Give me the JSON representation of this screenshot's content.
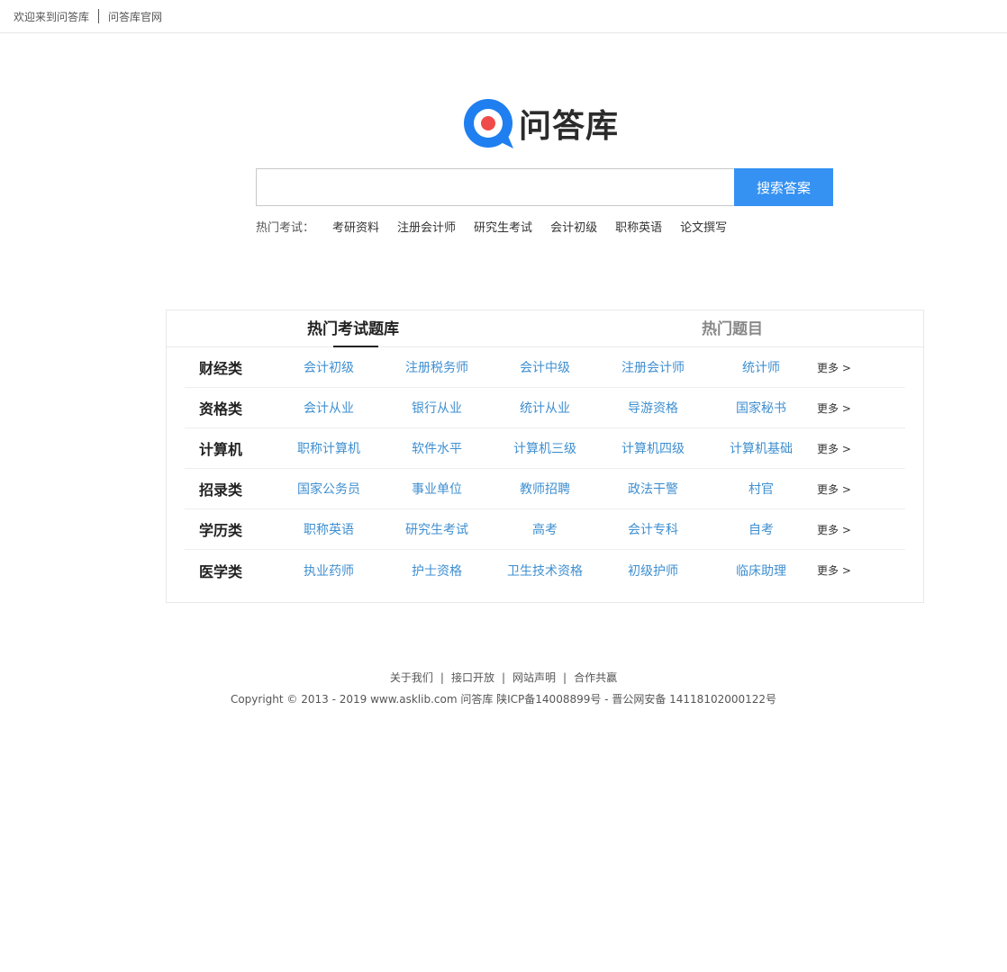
{
  "topbar": {
    "welcome": "欢迎来到问答库",
    "official_site": "问答库官网"
  },
  "logo": {
    "text": "问答库",
    "colors": {
      "ring": "#1f7ff0",
      "dot": "#ef4b4b"
    }
  },
  "search": {
    "placeholder": "",
    "button_label": "搜索答案",
    "button_color": "#3591f2"
  },
  "hot": {
    "label": "热门考试：",
    "items": [
      "考研资料",
      "注册会计师",
      "研究生考试",
      "会计初级",
      "职称英语",
      "论文撰写"
    ]
  },
  "panel": {
    "tabs": [
      "热门考试题库",
      "热门题目"
    ],
    "more_label": "更多 >",
    "rows": [
      {
        "category": "财经类",
        "links": [
          "会计初级",
          "注册税务师",
          "会计中级",
          "注册会计师",
          "统计师"
        ]
      },
      {
        "category": "资格类",
        "links": [
          "会计从业",
          "银行从业",
          "统计从业",
          "导游资格",
          "国家秘书"
        ]
      },
      {
        "category": "计算机",
        "links": [
          "职称计算机",
          "软件水平",
          "计算机三级",
          "计算机四级",
          "计算机基础"
        ]
      },
      {
        "category": "招录类",
        "links": [
          "国家公务员",
          "事业单位",
          "教师招聘",
          "政法干警",
          "村官"
        ]
      },
      {
        "category": "学历类",
        "links": [
          "职称英语",
          "研究生考试",
          "高考",
          "会计专科",
          "自考"
        ]
      },
      {
        "category": "医学类",
        "links": [
          "执业药师",
          "护士资格",
          "卫生技术资格",
          "初级护师",
          "临床助理"
        ]
      }
    ]
  },
  "footer": {
    "links": [
      "关于我们",
      "接口开放",
      "网站声明",
      "合作共赢"
    ],
    "separator": "|",
    "copyright": "Copyright © 2013 - 2019 www.asklib.com  问答库   陕ICP备14008899号 - 晋公网安备 14118102000122号"
  }
}
